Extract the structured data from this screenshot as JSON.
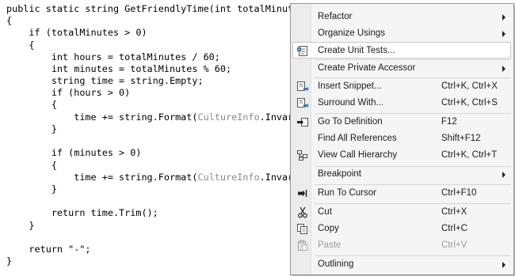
{
  "code": [
    {
      "text": "public static string GetFriendlyTime(int totalMinutes)"
    },
    {
      "text": "{"
    },
    {
      "text": "    if (totalMinutes > 0)"
    },
    {
      "text": "    {"
    },
    {
      "text": "        int hours = totalMinutes / 60;"
    },
    {
      "text": "        int minutes = totalMinutes % 60;"
    },
    {
      "text": "        string time = string.Empty;"
    },
    {
      "text": "        if (hours > 0)"
    },
    {
      "text": "        {"
    },
    {
      "pre": "            time += string.Format(",
      "cls": "CultureInfo",
      "post": ".Invarian"
    },
    {
      "text": "        }"
    },
    {
      "text": ""
    },
    {
      "text": "        if (minutes > 0)"
    },
    {
      "text": "        {"
    },
    {
      "pre": "            time += string.Format(",
      "cls": "CultureInfo",
      "post": ".Invarian"
    },
    {
      "text": "        }"
    },
    {
      "text": ""
    },
    {
      "text": "        return time.Trim();"
    },
    {
      "text": "    }"
    },
    {
      "text": ""
    },
    {
      "text": "    return \"-\";"
    },
    {
      "text": "}"
    }
  ],
  "context_menu": {
    "refactor": {
      "label": "Refactor"
    },
    "organize_usings": {
      "label": "Organize Usings"
    },
    "create_unit_tests": {
      "label": "Create Unit Tests...",
      "icon": "unit-test-icon"
    },
    "create_private_accessor": {
      "label": "Create Private Accessor"
    },
    "insert_snippet": {
      "label": "Insert Snippet...",
      "shortcut": "Ctrl+K, Ctrl+X",
      "icon": "snippet-icon"
    },
    "surround_with": {
      "label": "Surround With...",
      "shortcut": "Ctrl+K, Ctrl+S",
      "icon": "surround-icon"
    },
    "go_to_definition": {
      "label": "Go To Definition",
      "shortcut": "F12",
      "icon": "go-to-definition-icon"
    },
    "find_all_references": {
      "label": "Find All References",
      "shortcut": "Shift+F12"
    },
    "view_call_hierarchy": {
      "label": "View Call Hierarchy",
      "shortcut": "Ctrl+K, Ctrl+T",
      "icon": "call-hierarchy-icon"
    },
    "breakpoint": {
      "label": "Breakpoint"
    },
    "run_to_cursor": {
      "label": "Run To Cursor",
      "shortcut": "Ctrl+F10",
      "icon": "run-to-cursor-icon"
    },
    "cut": {
      "label": "Cut",
      "shortcut": "Ctrl+X",
      "icon": "scissors-icon"
    },
    "copy": {
      "label": "Copy",
      "shortcut": "Ctrl+C",
      "icon": "copy-icon"
    },
    "paste": {
      "label": "Paste",
      "shortcut": "Ctrl+V",
      "icon": "paste-icon",
      "disabled": true
    },
    "outlining": {
      "label": "Outlining"
    }
  },
  "colors": {
    "menu_bg": "#f5f5f5",
    "gutter_bg": "#ececec",
    "highlight_bg": "#ffffff",
    "disabled_text": "#9a9a9a",
    "type_name": "#8a8a8a"
  }
}
